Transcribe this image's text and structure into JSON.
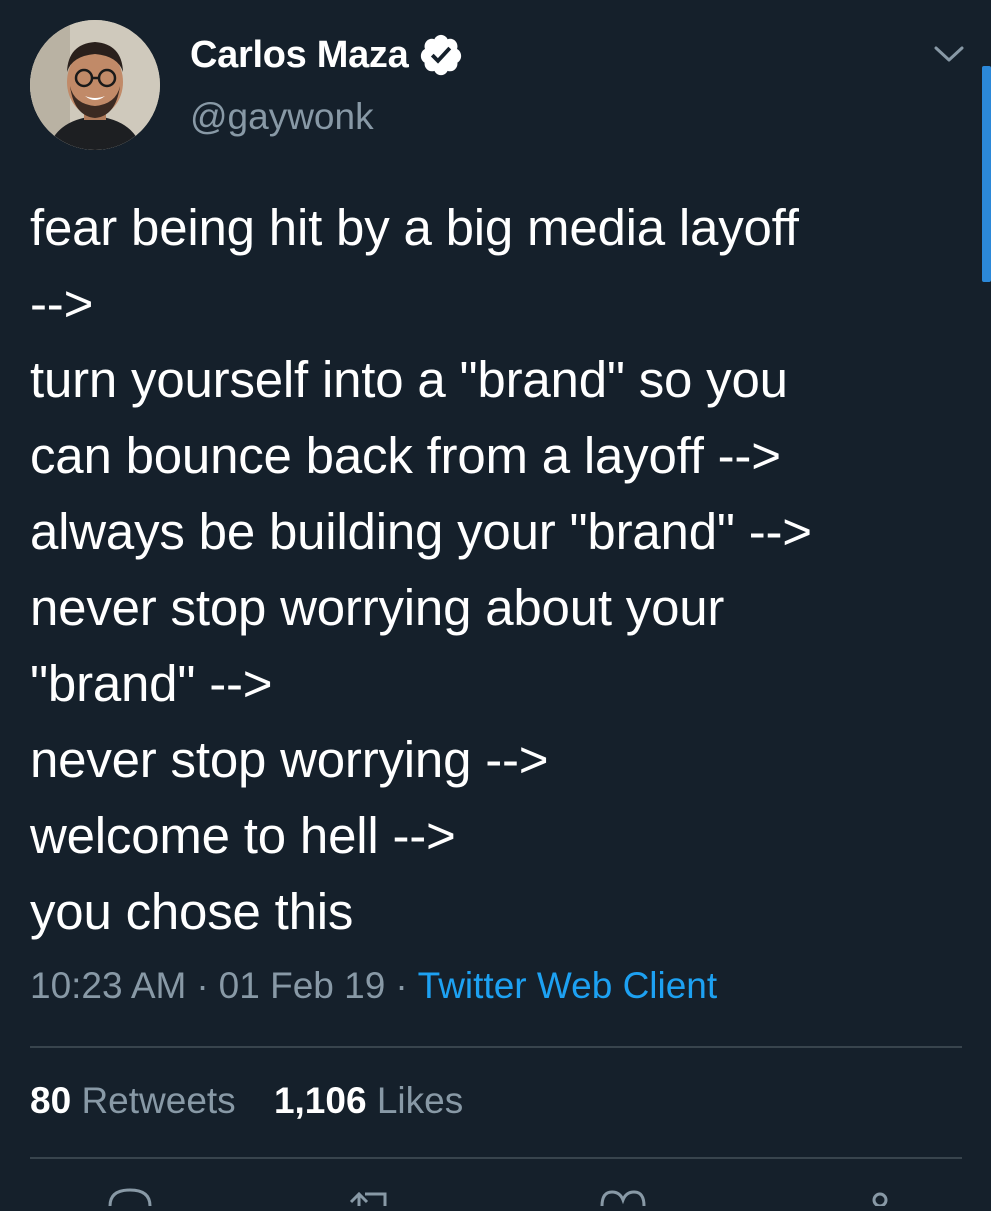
{
  "user": {
    "display_name": "Carlos Maza",
    "handle": "@gaywonk",
    "verified": true
  },
  "tweet": {
    "text": "fear being hit by a big media layoff\n-->\nturn yourself into a \"brand\" so you\ncan bounce back from a layoff  -->\nalways be building your \"brand\" -->\nnever stop worrying about your\n\"brand\" -->\nnever stop worrying -->\nwelcome to hell -->\nyou chose this",
    "time": "10:23 AM",
    "date": "01 Feb 19",
    "separator": "·",
    "client": "Twitter Web Client"
  },
  "stats": {
    "retweets_count": "80",
    "retweets_label": "Retweets",
    "likes_count": "1,106",
    "likes_label": "Likes"
  },
  "icons": {
    "verified": "verified-badge-icon",
    "menu": "chevron-down-icon",
    "reply": "reply-icon",
    "retweet": "retweet-icon",
    "like": "heart-icon",
    "share": "share-icon"
  },
  "colors": {
    "background": "#15202b",
    "text": "#ffffff",
    "secondary_text": "#8899a6",
    "accent": "#1da1f2",
    "divider": "#38444d"
  }
}
